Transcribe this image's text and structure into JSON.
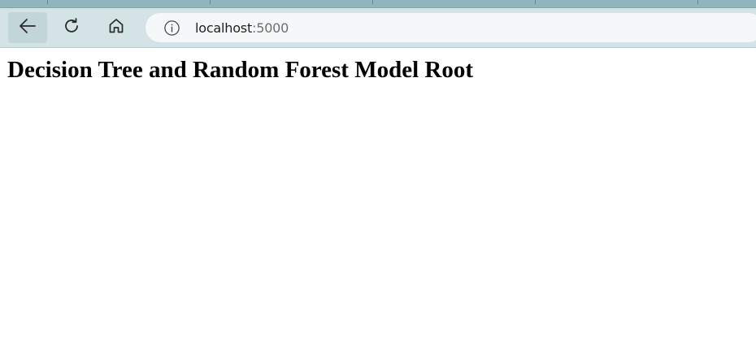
{
  "browser": {
    "address_bar": {
      "host": "localhost",
      "port": ":5000"
    },
    "icons": {
      "back": "back-arrow-icon",
      "refresh": "refresh-icon",
      "home": "home-icon",
      "site_info": "info-icon"
    },
    "colors": {
      "tabstrip": "#8fb5bd",
      "toolbar": "#d3e3e6",
      "address_bar": "#f5f8f8"
    }
  },
  "page": {
    "heading": "Decision Tree and Random Forest Model Root"
  }
}
